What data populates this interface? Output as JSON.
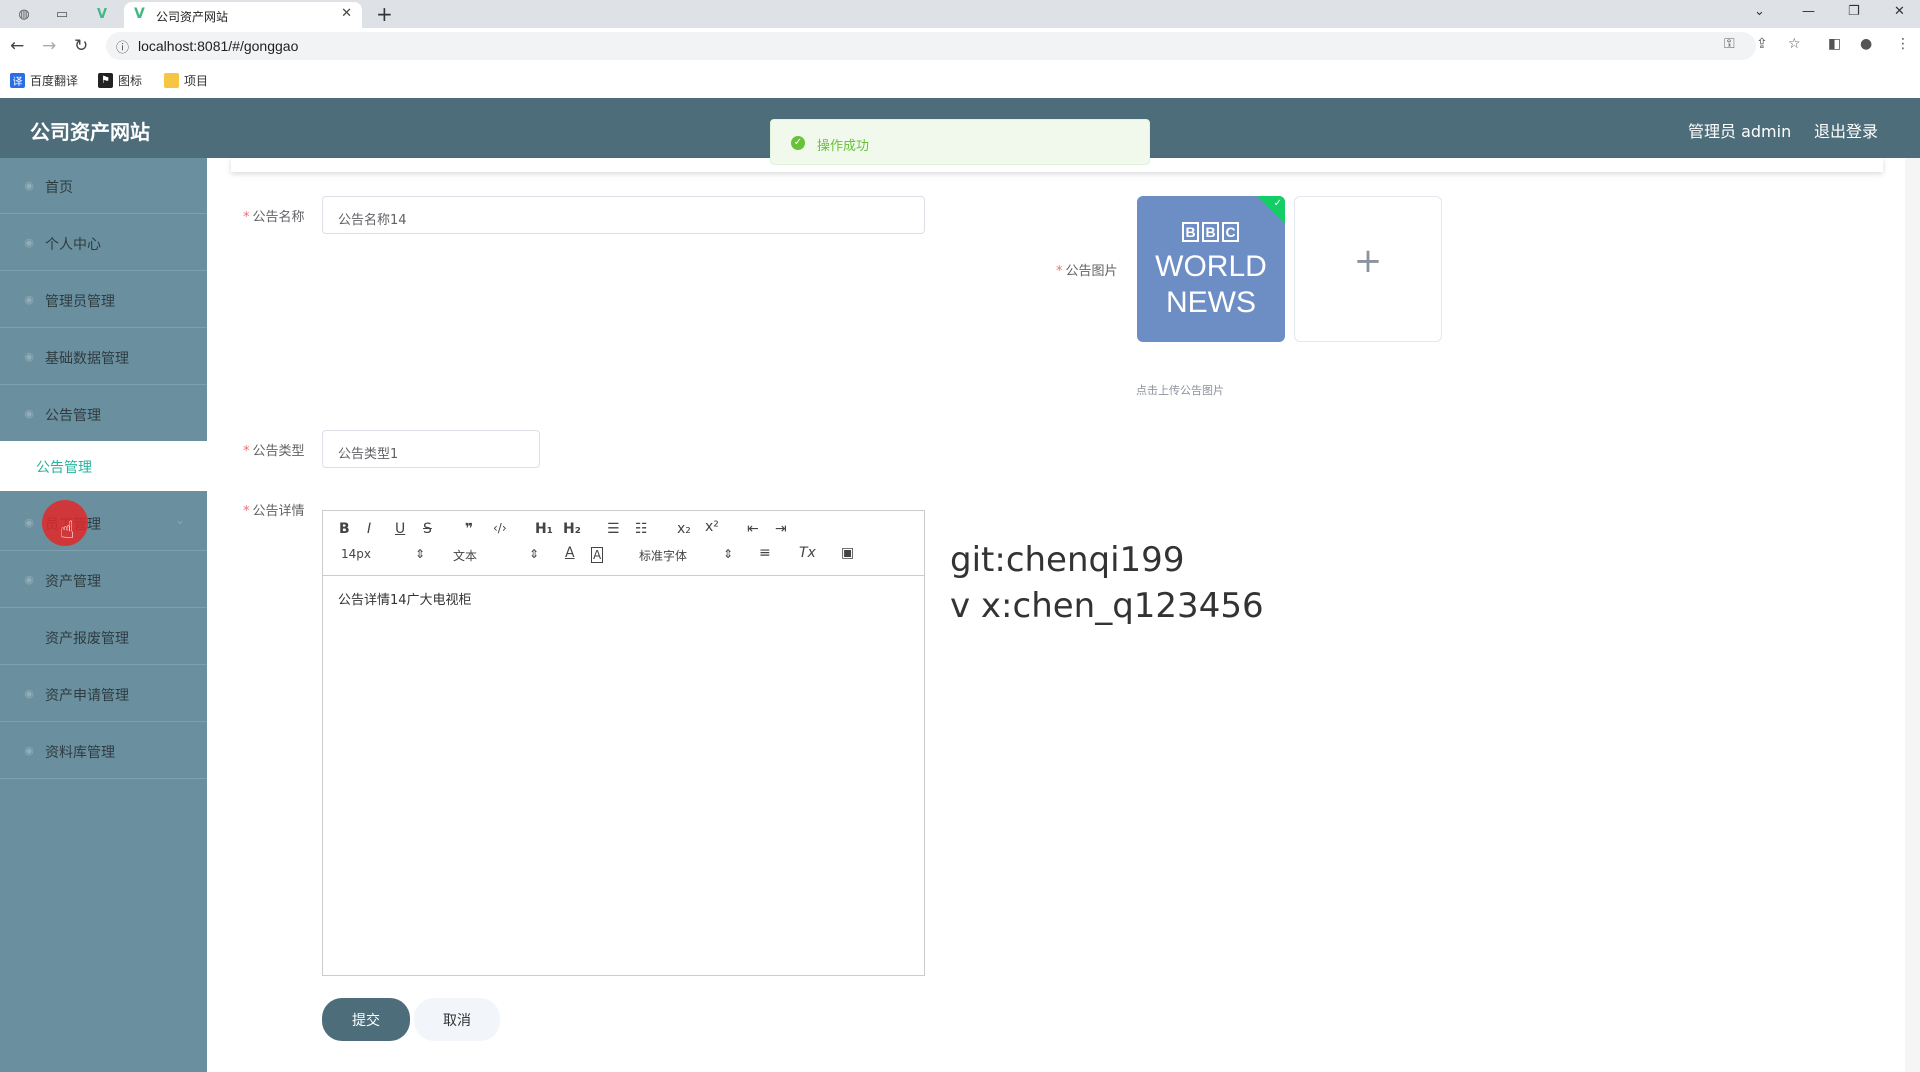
{
  "browser": {
    "tab_title": "公司资产网站",
    "url": "localhost:8081/#/gonggao",
    "bookmarks": [
      "百度翻译",
      "图标",
      "项目"
    ]
  },
  "header": {
    "brand": "公司资产网站",
    "user": "管理员 admin",
    "logout": "退出登录"
  },
  "toast": {
    "message": "操作成功"
  },
  "sidebar": {
    "items": [
      {
        "label": "首页"
      },
      {
        "label": "个人中心"
      },
      {
        "label": "管理员管理"
      },
      {
        "label": "基础数据管理"
      },
      {
        "label": "公告管理"
      },
      {
        "label": "公告管理"
      },
      {
        "label": "员工管理"
      },
      {
        "label": "资产管理"
      },
      {
        "label": "资产报废管理"
      },
      {
        "label": "资产申请管理"
      },
      {
        "label": "资料库管理"
      }
    ]
  },
  "form": {
    "name_label": "公告名称",
    "name_value": "公告名称14",
    "image_label": "公告图片",
    "image_hint": "点击上传公告图片",
    "thumb_text": {
      "letters": [
        "B",
        "B",
        "C"
      ],
      "line1": "WORLD",
      "line2": "NEWS"
    },
    "type_label": "公告类型",
    "type_value": "公告类型1",
    "detail_label": "公告详情",
    "editor": {
      "font_size": "14px",
      "header_select": "文本",
      "font_family": "标准字体",
      "content": "公告详情14广大电视柜"
    },
    "submit": "提交",
    "cancel": "取消"
  },
  "watermark": {
    "line1": "git:chenqi199",
    "line2": "v x:chen_q123456"
  }
}
